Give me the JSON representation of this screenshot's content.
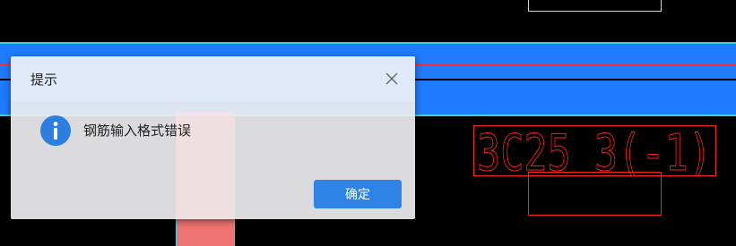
{
  "dialog": {
    "title": "提示",
    "message": "钢筋输入格式错误",
    "ok_label": "确定"
  },
  "drawing": {
    "annotation_text": "3C25 3(-1)",
    "colors": {
      "beam_fill": "#1f7bff",
      "beam_edge": "#35d4e6",
      "annotation": "#ff2020",
      "column": "#ee7373",
      "background": "#000000"
    }
  },
  "icons": {
    "info": "info-icon",
    "close": "close-icon"
  }
}
